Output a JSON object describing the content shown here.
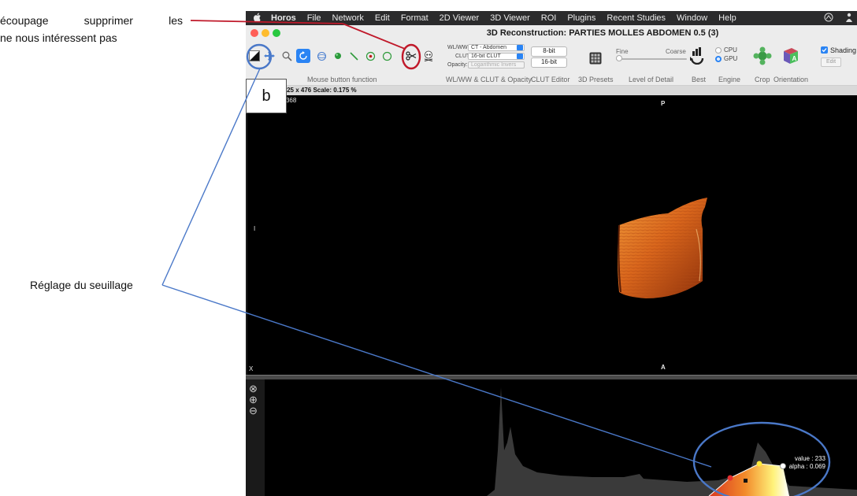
{
  "annotations": {
    "cutting_line1": "écoupage supprimer les",
    "cutting_line2": "ne nous intéressent pas",
    "threshold": "Réglage du seuillage",
    "label_b": "b"
  },
  "menubar": {
    "apple": "",
    "app_name": "Horos",
    "items": [
      "File",
      "Network",
      "Edit",
      "Format",
      "2D Viewer",
      "3D Viewer",
      "ROI",
      "Plugins",
      "Recent Studies",
      "Window",
      "Help"
    ]
  },
  "window": {
    "title": "3D Reconstruction: PARTIES MOLLES ABDOMEN 0.5 (3)"
  },
  "toolbar": {
    "wlww_label": "WL/WW:",
    "wlww_value": "CT - Abdomen",
    "clut_label": "CLUT:",
    "clut_value": "16-bit CLUT",
    "opacity_label": "Opacity:",
    "opacity_value": "Logarithmic Invers",
    "bit8": "8-bit",
    "bit16": "16-bit",
    "fine": "Fine",
    "coarse": "Coarse",
    "cpu": "CPU",
    "gpu": "GPU",
    "shading": "Shading",
    "edit": "Edit",
    "sections": {
      "mouse": "Mouse button function",
      "wlww": "WL/WW & CLUT & Opacity",
      "clut_editor": "CLUT Editor",
      "presets": "3D Presets",
      "lod": "Level of Detail",
      "best": "Best",
      "engine": "Engine",
      "crop": "Crop",
      "orientation": "Orientation"
    }
  },
  "status": "View Size: 1425 x 476  Scale: 0.175 %",
  "viewer": {
    "wl_ww": "WL: 49 WW: 368",
    "orient_top": "P",
    "orient_left": "I",
    "orient_bottom": "A",
    "corner_x": "X"
  },
  "histogram": {
    "value": "value : 233",
    "alpha": "alpha : 0.069"
  },
  "colors": {
    "annotation_red": "#c0192a",
    "annotation_blue": "#4a78c8",
    "selected_tool": "#2a84f4",
    "volume_orange": "#d9661c"
  }
}
